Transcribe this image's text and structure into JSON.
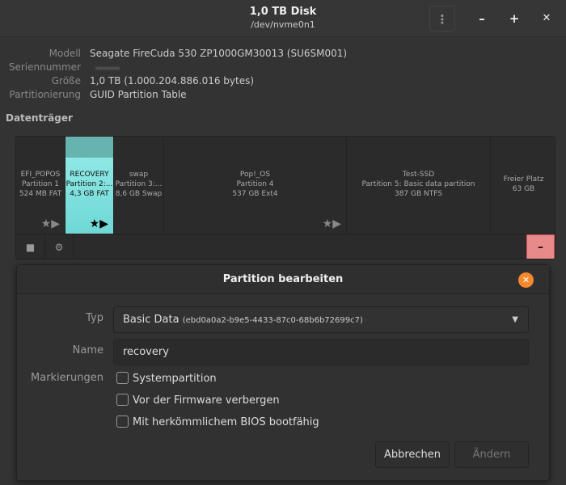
{
  "window": {
    "title": "1,0 TB Disk",
    "subtitle": "/dev/nvme0n1",
    "menu_icon": "⋮",
    "minimize": "–",
    "maximize": "+",
    "close": "✕"
  },
  "disk": {
    "rows": [
      {
        "label": "Modell",
        "value": "Seagate FireCuda 530 ZP1000GM30013 (SU6SM001)"
      },
      {
        "label": "Seriennummer",
        "value": ""
      },
      {
        "label": "Größe",
        "value": "1,0 TB (1.000.204.886.016 bytes)"
      },
      {
        "label": "Partitionierung",
        "value": "GUID Partition Table"
      }
    ],
    "section": "Datenträger"
  },
  "partitions": [
    {
      "name": "EFI_POPOS",
      "desc": "Partition 1",
      "size": "524 MB FAT"
    },
    {
      "name": "RECOVERY",
      "desc": "Partition 2:...",
      "size": "4,3 GB FAT"
    },
    {
      "name": "swap",
      "desc": "Partition 3:...",
      "size": "8,6 GB Swap"
    },
    {
      "name": "Pop!_OS",
      "desc": "Partition 4",
      "size": "537 GB Ext4"
    },
    {
      "name": "Test-SSD",
      "desc": "Partition 5: Basic data partition",
      "size": "387 GB NTFS"
    },
    {
      "name": "Freier Platz",
      "desc": "63 GB"
    }
  ],
  "toolbar": {
    "stop_icon": "■",
    "settings_icon": "⚙",
    "delete": "–"
  },
  "dialog": {
    "title": "Partition bearbeiten",
    "type_label": "Typ",
    "type_value": "Basic Data",
    "type_guid": "(ebd0a0a2-b9e5-4433-87c0-68b6b72699c7)",
    "name_label": "Name",
    "name_value": "recovery",
    "flags_label": "Markierungen",
    "flags": [
      {
        "label": "Systempartition",
        "checked": false
      },
      {
        "label": "Vor der Firmware verbergen",
        "checked": false
      },
      {
        "label": "Mit herkömmlichem BIOS bootfähig",
        "checked": false
      }
    ],
    "cancel": "Abbrechen",
    "apply": "Ändern"
  }
}
